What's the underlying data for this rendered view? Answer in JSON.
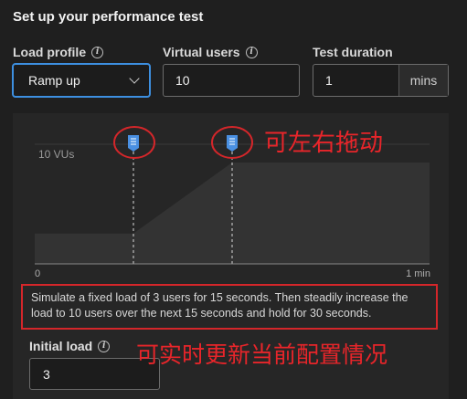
{
  "header": {
    "title": "Set up your performance test"
  },
  "fields": {
    "load_profile": {
      "label": "Load profile",
      "value": "Ramp up"
    },
    "virtual_users": {
      "label": "Virtual users",
      "value": "10"
    },
    "test_duration": {
      "label": "Test duration",
      "value": "1",
      "unit": "mins"
    },
    "initial_load": {
      "label": "Initial load",
      "value": "3"
    }
  },
  "chart": {
    "y_marker_label": "10 VUs",
    "x_start_label": "0",
    "x_end_label": "1 min"
  },
  "description": "Simulate a fixed load of 3 users for 15 seconds. Then steadily increase the load to 10 users over the next 15 seconds and hold for 30 seconds.",
  "annotations": {
    "drag_hint": "可左右拖动",
    "live_update_hint": "可实时更新当前配置情况"
  },
  "colors": {
    "accent": "#3d8fe0",
    "annotation": "#e8252a",
    "area_fill": "#333333"
  },
  "chart_data": {
    "type": "area",
    "x": [
      0,
      15,
      30,
      60
    ],
    "values": [
      3,
      3,
      10,
      10
    ],
    "x_unit": "seconds",
    "ylim": [
      0,
      10
    ]
  }
}
